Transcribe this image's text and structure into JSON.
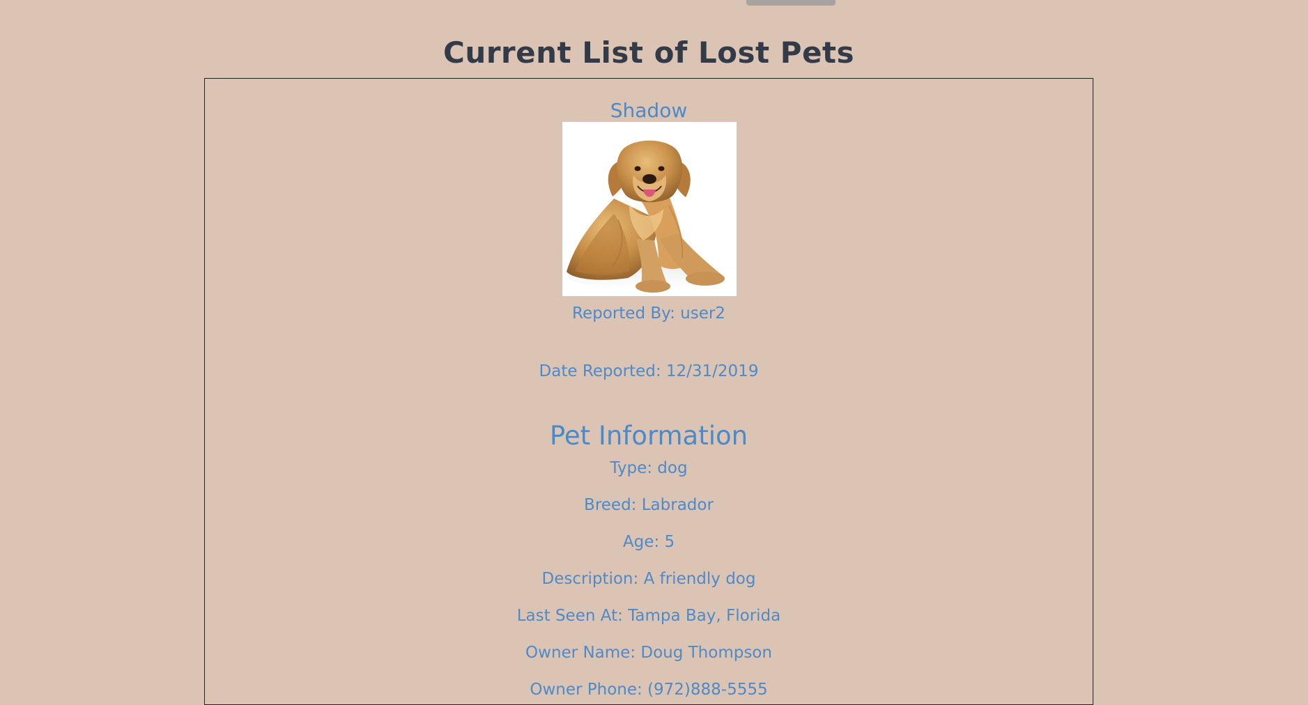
{
  "search": {
    "button_label": ""
  },
  "page": {
    "title": "Current List of Lost Pets"
  },
  "pet": {
    "name": "Shadow",
    "reported_by": "Reported By: user2",
    "date_reported": "Date Reported: 12/31/2019",
    "info_heading": "Pet Information",
    "type": "Type: dog",
    "breed": "Breed: Labrador",
    "age": "Age: 5",
    "description": "Description: A friendly dog",
    "last_seen": "Last Seen At: Tampa Bay, Florida",
    "owner_name": "Owner Name: Doug Thompson",
    "owner_phone": "Owner Phone: (972)888-5555"
  },
  "colors": {
    "background": "#dcc4b5",
    "title": "#323b47",
    "accent": "#4d8ac7"
  }
}
